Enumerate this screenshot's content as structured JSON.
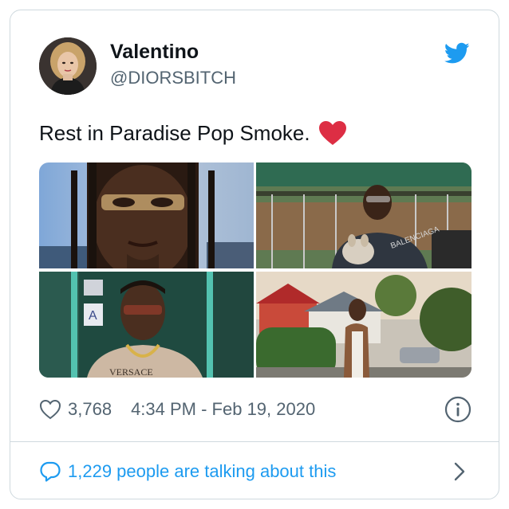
{
  "author": {
    "name": "Valentino",
    "handle": "@DIORSBITCH",
    "avatar_icon": "profile-photo"
  },
  "brand_icon": "twitter-bird-icon",
  "tweet": {
    "text": "Rest in Paradise Pop Smoke.",
    "emoji": "red-heart"
  },
  "media": {
    "count": 4,
    "photos": [
      {
        "position": "top-left",
        "description_icon": "photo-portrait-closeup"
      },
      {
        "position": "top-right",
        "description_icon": "photo-with-dog"
      },
      {
        "position": "bottom-left",
        "description_icon": "photo-portrait-chain"
      },
      {
        "position": "bottom-right",
        "description_icon": "photo-suburban-street"
      }
    ]
  },
  "stats": {
    "likes": "3,768",
    "timestamp": "4:34 PM - Feb 19, 2020"
  },
  "footer": {
    "talking_label": "1,229 people are talking about this"
  },
  "colors": {
    "accent": "#1d9bf0",
    "heart": "#e0245e",
    "muted": "#536471",
    "border": "#cfd9de"
  }
}
